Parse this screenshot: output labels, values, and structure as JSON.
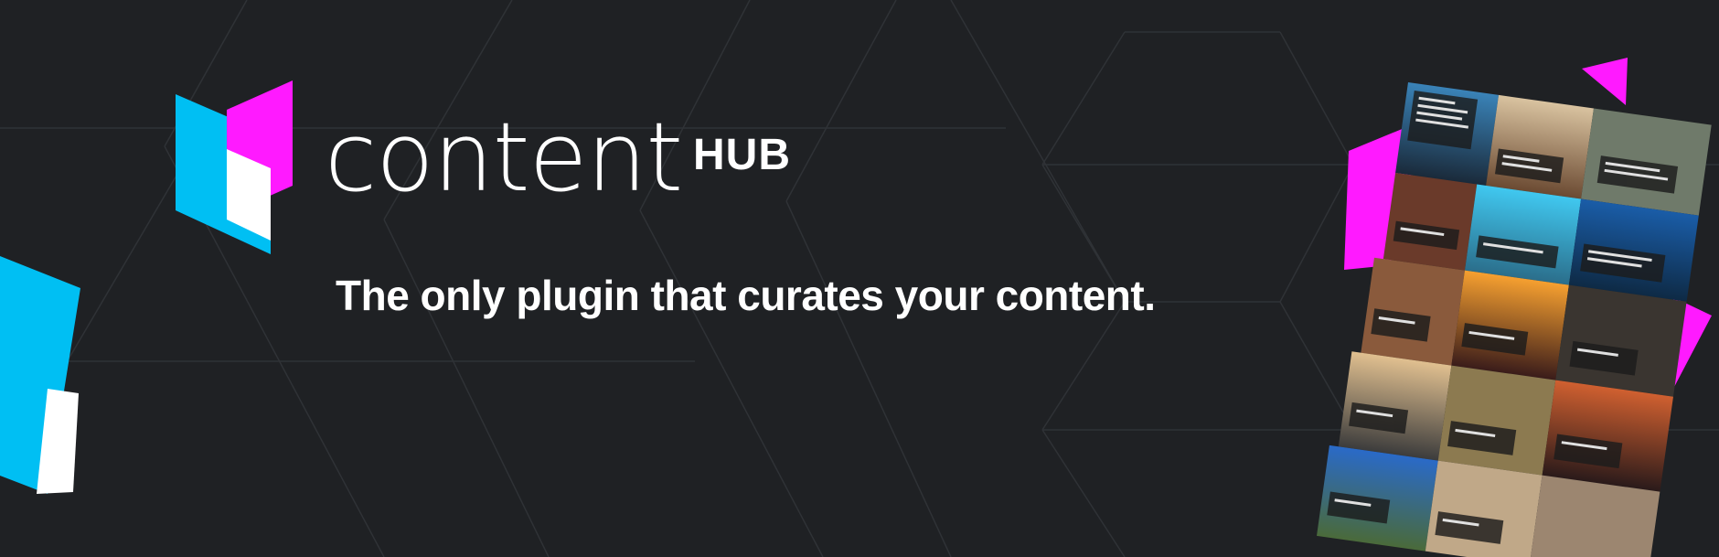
{
  "brand": {
    "name": "content",
    "superscript": "HUB"
  },
  "tagline": "The only plugin that curates your content.",
  "colors": {
    "background": "#1f2124",
    "accent_cyan": "#00bff3",
    "accent_magenta": "#ff1aff",
    "text": "#ffffff"
  },
  "icons": {
    "logo": "content-hub-logo-icon"
  },
  "collage": {
    "description_items": [
      "city-photo-tiles"
    ]
  }
}
